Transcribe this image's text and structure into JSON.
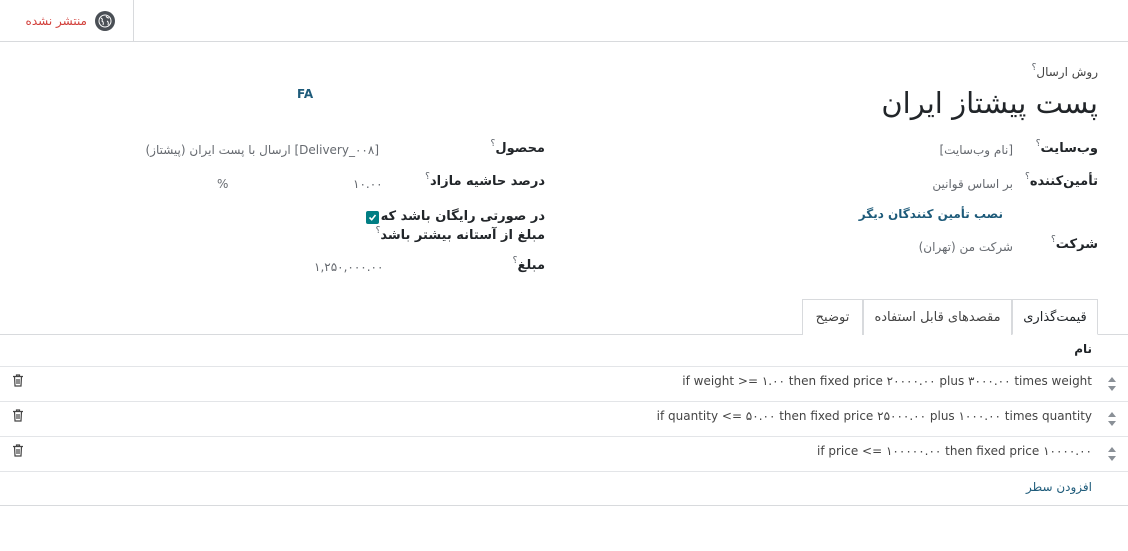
{
  "header": {
    "publish_status": "منتشر نشده",
    "publish_icon": "globe-icon",
    "status_color": "#d23f3a"
  },
  "form": {
    "method_label": "روش ارسال",
    "method_name": "پست پیشتاز ایران",
    "lang_button": "FA",
    "website_label": "وب‌سایت",
    "website_value": "[نام وب‌سایت]",
    "provider_label": "تأمین‌کننده",
    "provider_value": "بر اساس قوانین",
    "install_more_link": "نصب تأمین کنندگان دیگر",
    "company_label": "شرکت",
    "company_value": "شرکت من (تهران)",
    "product_label": "محصول",
    "product_value": "[Delivery_۰۰۸] ارسال با پست ایران (پیشتاز)",
    "margin_label": "درصد حاشیه مازاد",
    "margin_value": "۱۰.۰۰",
    "margin_unit": "%",
    "free_label_line1": "در صورتی رایگان باشد که",
    "free_label_line2": "مبلغ از آستانه بیشتر باشد",
    "free_checked": true,
    "amount_label": "مبلغ",
    "amount_value": "۱,۲۵۰,۰۰۰.۰۰",
    "help_mark": "؟"
  },
  "tabs": [
    {
      "label": "قیمت‌گذاری",
      "active": true
    },
    {
      "label": "مقصدهای قابل استفاده",
      "active": false
    },
    {
      "label": "توضیح",
      "active": false
    }
  ],
  "rules": {
    "column_name": "نام",
    "rows": [
      "if weight >= ۱.۰۰ then fixed price ۲۰۰۰۰.۰۰ plus ۳۰۰۰.۰۰ times weight",
      "if quantity <= ۵۰.۰۰ then fixed price ۲۵۰۰۰.۰۰ plus ۱۰۰۰.۰۰ times quantity",
      "if price <= ۱۰۰۰۰۰.۰۰ then fixed price ۱۰۰۰۰.۰۰"
    ],
    "add_line": "افزودن سطر",
    "accent_color": "#017e84"
  }
}
